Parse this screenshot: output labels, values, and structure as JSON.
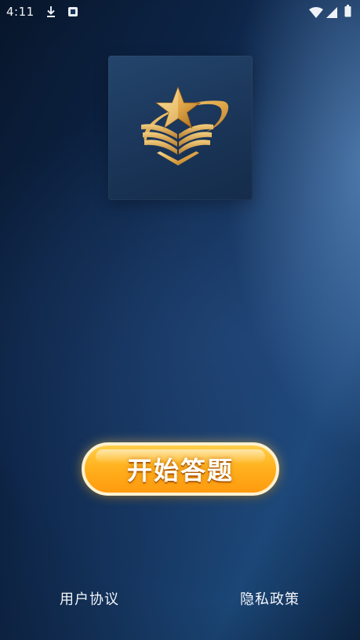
{
  "status_bar": {
    "time": "4:11",
    "icons": [
      "download-icon",
      "notification-icon",
      "wifi-icon",
      "cell-signal-icon",
      "battery-icon"
    ]
  },
  "logo": {
    "icon": "star-book-emblem-icon",
    "colors": {
      "tile": "#1a3558",
      "gold": "#e1a84a"
    }
  },
  "start_button": {
    "label": "开始答题",
    "color": "#ffb21f"
  },
  "footer": {
    "user_agreement": "用户协议",
    "privacy_policy": "隐私政策"
  }
}
